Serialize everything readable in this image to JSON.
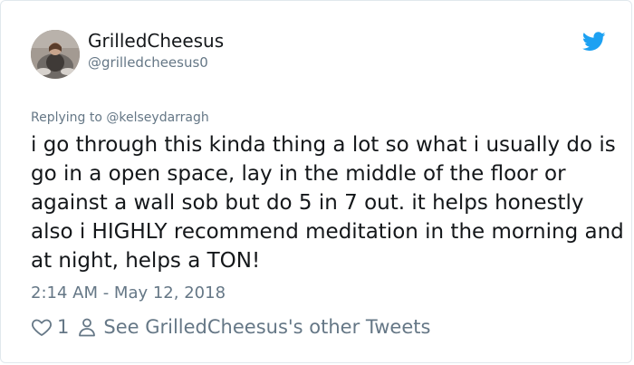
{
  "tweet": {
    "display_name": "GrilledCheesus",
    "handle": "@grilledcheesus0",
    "reply_prefix": "Replying to",
    "reply_to": "@kelseydarragh",
    "text": "i go through this kinda thing a lot so what i usually do is go in a open space, lay in the middle of the floor or against a wall sob but do 5 in 7 out. it helps honestly also i HIGHLY recommend meditation in the morning and at night, helps a TON!",
    "timestamp": "2:14 AM - May 12, 2018",
    "like_count": "1",
    "other_tweets_link": "See GrilledCheesus's other Tweets"
  },
  "icons": {
    "brand": "twitter-bird-icon",
    "like": "heart-icon",
    "profile": "person-icon"
  },
  "colors": {
    "twitter_blue": "#1da1f2",
    "secondary_text": "#657786",
    "primary_text": "#14171a",
    "border": "#e1e8ed"
  }
}
